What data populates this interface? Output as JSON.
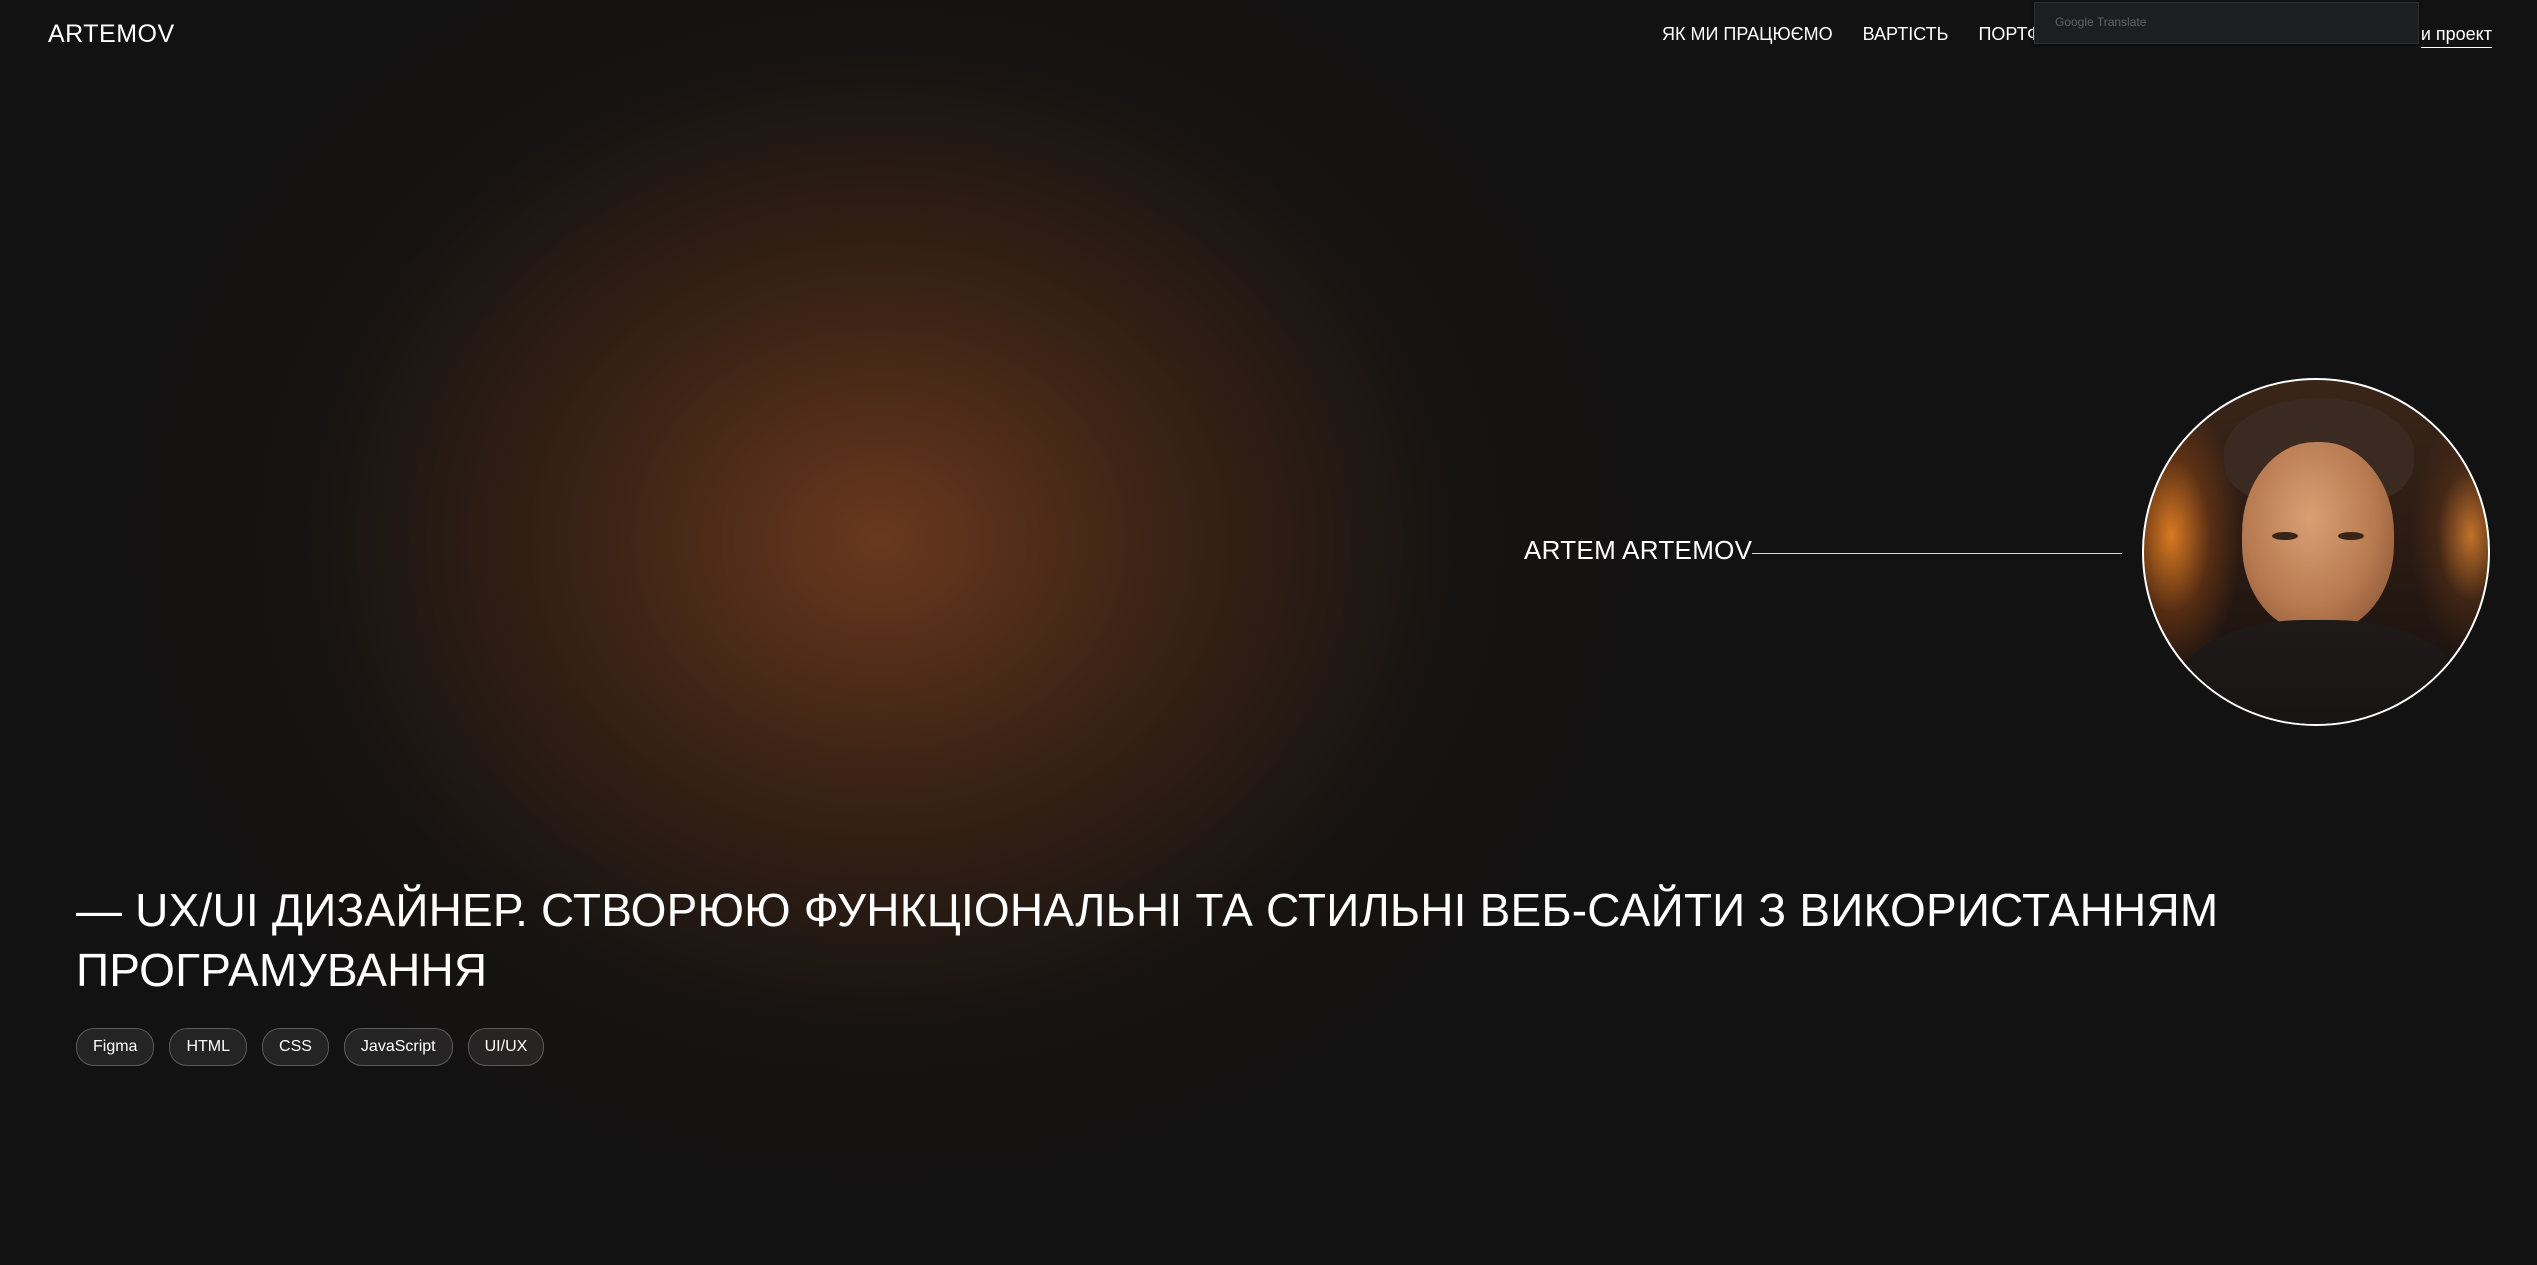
{
  "header": {
    "logo": "ARTEMOV",
    "nav": [
      "ЯК МИ ПРАЦЮЄМО",
      "ВАРТІСТЬ",
      "ПОРТФОЛ"
    ],
    "cta": "и проект"
  },
  "google_translate": {
    "label": "Google Translate"
  },
  "hero": {
    "name": "ARTEM ARTEMOV",
    "headline": "— UX/UI ДИЗАЙНЕР. СТВОРЮЮ ФУНКЦІОНАЛЬНІ ТА СТИЛЬНІ ВЕБ-САЙТИ З ВИКОРИСТАННЯМ ПРОГРАМУВАННЯ",
    "tags": [
      "Figma",
      "HTML",
      "CSS",
      "JavaScript",
      "UI/UX"
    ]
  },
  "colors": {
    "background": "#121212",
    "glow": "#6e3a1e",
    "text": "#ffffff"
  }
}
